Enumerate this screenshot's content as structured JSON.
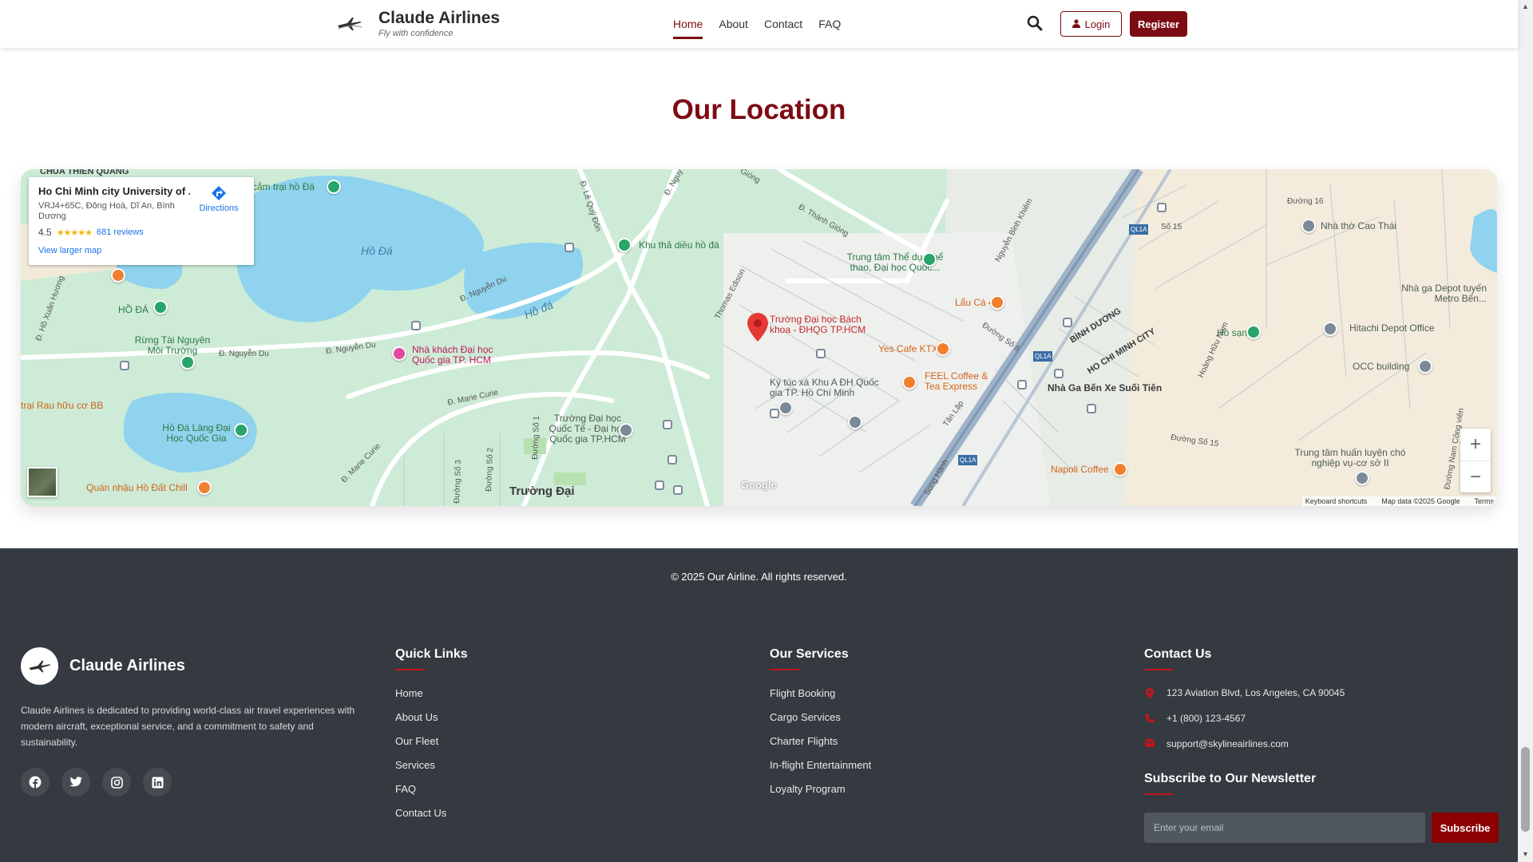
{
  "header": {
    "brand_name": "Claude Airlines",
    "tagline": "Fly with confidence",
    "nav": [
      {
        "label": "Home",
        "active": true
      },
      {
        "label": "About",
        "active": false
      },
      {
        "label": "Contact",
        "active": false
      },
      {
        "label": "FAQ",
        "active": false
      }
    ],
    "search_icon": "search-icon",
    "login_label": "Login",
    "register_label": "Register"
  },
  "location": {
    "title": "Our Location",
    "map": {
      "place_name": "Ho Chi Minh city University of ...",
      "address": "VRJ4+65C, Đông Hoà, Dĩ An, Bình Dương",
      "rating": "4.5",
      "stars": "★★★★★",
      "reviews": "681 reviews",
      "view_larger": "View larger map",
      "directions": "Directions",
      "zoom_in": "+",
      "zoom_out": "−",
      "keyboard_shortcuts": "Keyboard shortcuts",
      "map_data": "Map data ©2025 Google",
      "terms": "Terms",
      "google_logo": "Google",
      "labels": {
        "chua": "CHÙA THIÊN QUANG",
        "cam_trai": "cắm trại hồ Đá",
        "ho_da_1": "Hồ Đá",
        "ho_da_2": "Hồ đá",
        "ho_da_pin": "HỒ ĐÁ",
        "rung": "Rừng Tài Nguyên Môi Trường",
        "trai_rau": "trại Rau hữu cơ BB",
        "ho_da_lang": "Hồ Đá Làng Đại Học Quốc Gia",
        "quan_nhau": "Quán nhậu Hồ Đất Chill",
        "khu_tha": "Khu thả diều hồ đá",
        "nha_khach": "Nhà khách Đại học Quốc gia TP. HCM",
        "truong_qt": "Trường Đại học Quốc Tế - Đại học Quốc gia TP.HCM",
        "truong_dai": "Trường Đại",
        "bach_khoa": "Trường Đại học Bách khoa - ĐHQG TP.HCM",
        "trung_tam_td": "Trung tâm Thể dục thể thao, Đại học Quốc...",
        "yes_cafe": "Yes Cafe KTX",
        "ky_tuc_xa": "Ký túc xá Khu A ĐH Quốc gia TP. Hồ Chí Minh",
        "feel": "FEEL Coffee & Tea Express",
        "lau_ca": "Lẩu Cá 44",
        "nha_ga": "Nhà Ga Bến Xe Suối Tiên",
        "ho_san": "Hồ sạn",
        "hitachi": "Hitachi Depot Office",
        "occ": "OCC building",
        "nha_tho": "Nhà thờ Cao Thái",
        "depot": "Nhà ga Depot tuyến Metro Bến...",
        "huan_luyen": "Trung tâm huấn luyện chó nghiệp vụ-cơ sở II",
        "napoli": "Napoli Coffee",
        "binh_duong": "BÌNH DƯƠNG",
        "hcm_city": "HO CHI MINH CITY",
        "d_ho_xuan_huong": "Đ. Hồ Xuân Hương",
        "d_nguyen_du_1": "Đ. Nguyễn Du",
        "d_nguyen_du_2": "Đ. Nguyễn Du",
        "d_nguyen_du_3": "Đ. Nguyễn Du",
        "d_marie_curie_1": "Đ. Marie Curie",
        "d_marie_curie_2": "Đ. Marie Curie",
        "d_le_quy_don": "Đ. Lê Quý Đôn",
        "d_nguy": "Đ. Nguy",
        "d_thanh_giong": "Đ. Thánh Gióng",
        "giong": "Gióng",
        "thomas_edison": "Thomas Edison",
        "nguyen_binh_khiem": "Nguyễn Bỉnh Khiêm",
        "duong_so_6": "Đường Số 6",
        "tan_lap": "Tân Lập",
        "song_hanh": "Song Hành",
        "ql1a_1": "QL1A",
        "ql1a_2": "QL1A",
        "ql1a_3": "QL1A",
        "so_15": "Số 15",
        "duong_so_15": "Đường Số 15",
        "duong_16": "Đường 16",
        "duong_so_1": "Đường Số 1",
        "duong_so_2": "Đường Số 2",
        "duong_so_3": "Đường Số 3",
        "hoang_huu_nam": "Hoàng Hữu Nam",
        "duong_nam_cong_vien": "Đường Nam Công viên"
      }
    }
  },
  "footer": {
    "copyright": "© 2025 Our Airline. All rights reserved.",
    "brand_name": "Claude Airlines",
    "about": "Claude Airlines is dedicated to providing world-class air travel experiences with modern aircraft, exceptional service, and a commitment to safety and sustainability.",
    "socials": [
      "facebook-icon",
      "twitter-icon",
      "instagram-icon",
      "linkedin-icon"
    ],
    "quick_links": {
      "title": "Quick Links",
      "items": [
        "Home",
        "About Us",
        "Our Fleet",
        "Services",
        "FAQ",
        "Contact Us"
      ]
    },
    "services": {
      "title": "Our Services",
      "items": [
        "Flight Booking",
        "Cargo Services",
        "Charter Flights",
        "In-flight Entertainment",
        "Loyalty Program"
      ]
    },
    "contact": {
      "title": "Contact Us",
      "address": "123 Aviation Blvd, Los Angeles, CA 90045",
      "phone": "+1 (800) 123-4567",
      "email": "support@skylineairlines.com"
    },
    "newsletter": {
      "title": "Subscribe to Our Newsletter",
      "placeholder": "Enter your email",
      "button": "Subscribe"
    }
  },
  "colors": {
    "brand": "#7d0b13",
    "footer_bg": "#343a40",
    "accent_underline": "#c0151f",
    "subscribe_bg": "#8b0000"
  }
}
